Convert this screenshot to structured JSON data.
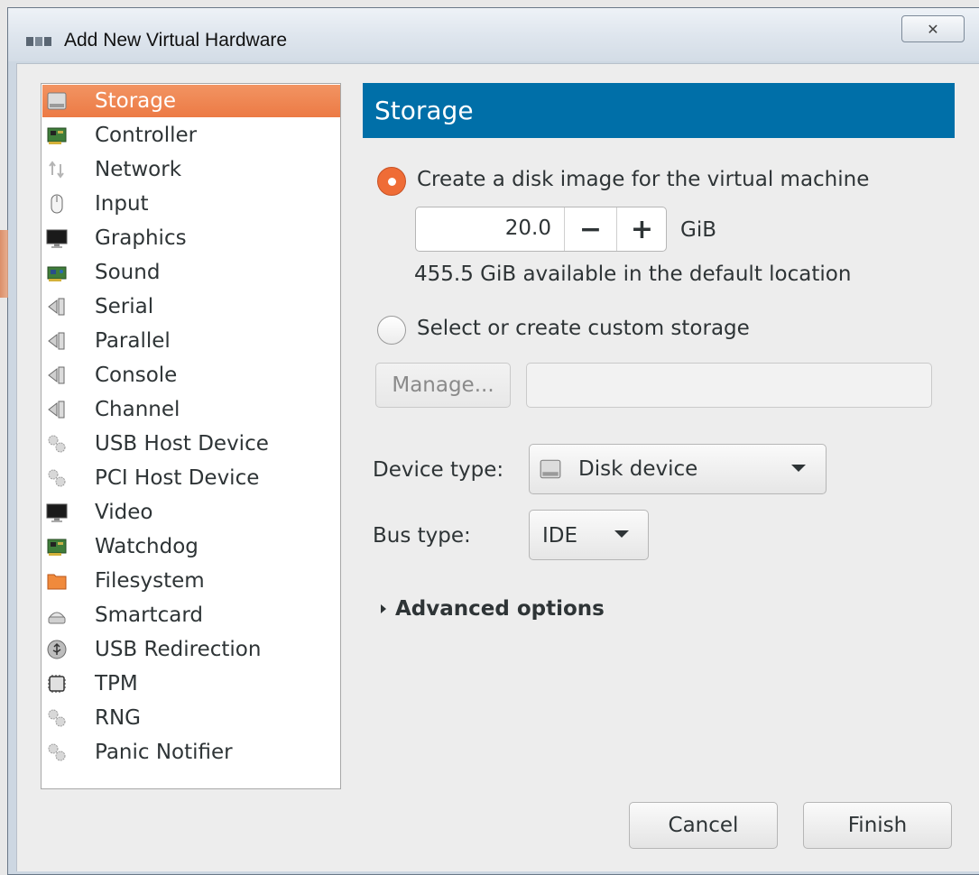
{
  "window": {
    "title": "Add New Virtual Hardware",
    "close_glyph": "✕"
  },
  "sidebar": {
    "items": [
      {
        "label": "Storage",
        "icon": "disk-icon",
        "selected": true
      },
      {
        "label": "Controller",
        "icon": "controller-card-icon"
      },
      {
        "label": "Network",
        "icon": "network-arrows-icon"
      },
      {
        "label": "Input",
        "icon": "mouse-icon"
      },
      {
        "label": "Graphics",
        "icon": "monitor-icon"
      },
      {
        "label": "Sound",
        "icon": "sound-card-icon"
      },
      {
        "label": "Serial",
        "icon": "serial-port-icon"
      },
      {
        "label": "Parallel",
        "icon": "parallel-port-icon"
      },
      {
        "label": "Console",
        "icon": "console-port-icon"
      },
      {
        "label": "Channel",
        "icon": "channel-port-icon"
      },
      {
        "label": "USB Host Device",
        "icon": "usb-gears-icon"
      },
      {
        "label": "PCI Host Device",
        "icon": "pci-gears-icon"
      },
      {
        "label": "Video",
        "icon": "video-monitor-icon"
      },
      {
        "label": "Watchdog",
        "icon": "watchdog-card-icon"
      },
      {
        "label": "Filesystem",
        "icon": "folder-icon"
      },
      {
        "label": "Smartcard",
        "icon": "smartcard-reader-icon"
      },
      {
        "label": "USB Redirection",
        "icon": "usb-redirection-icon"
      },
      {
        "label": "TPM",
        "icon": "chip-icon"
      },
      {
        "label": "RNG",
        "icon": "rng-gears-icon"
      },
      {
        "label": "Panic Notifier",
        "icon": "panic-gears-icon"
      }
    ]
  },
  "panel": {
    "header": "Storage",
    "option_create": "Create a disk image for the virtual machine",
    "size_value": "20.0",
    "size_unit": "GiB",
    "minus_label": "−",
    "plus_label": "+",
    "available_text": "455.5 GiB available in the default location",
    "option_custom": "Select or create custom storage",
    "manage_label": "Manage...",
    "custom_path_value": "",
    "device_type_label": "Device type:",
    "device_type_value": "Disk device",
    "bus_type_label": "Bus type:",
    "bus_type_value": "IDE",
    "advanced_label": "Advanced options"
  },
  "buttons": {
    "cancel": "Cancel",
    "finish": "Finish"
  },
  "colors": {
    "selection": "#ec7a45",
    "header": "#006fa8"
  }
}
